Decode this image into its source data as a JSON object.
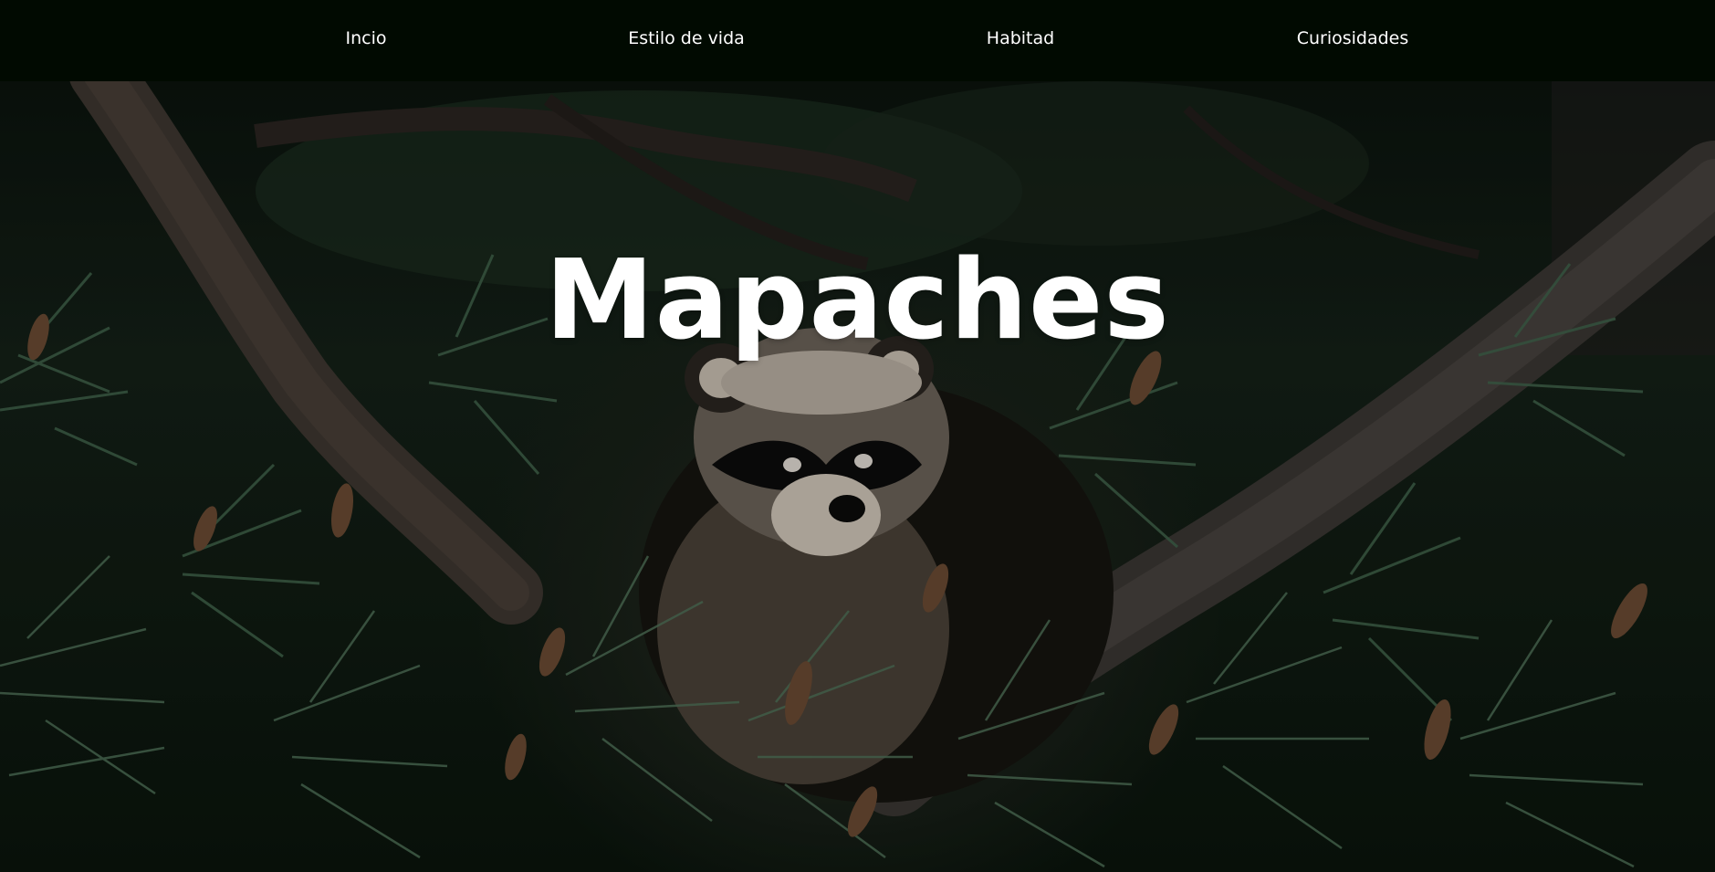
{
  "nav": {
    "items": [
      {
        "label": "Incio"
      },
      {
        "label": "Estilo de vida"
      },
      {
        "label": "Habitad"
      },
      {
        "label": "Curiosidades"
      }
    ]
  },
  "hero": {
    "title": "Mapaches",
    "background": "raccoon-in-pine-tree-photo"
  },
  "colors": {
    "nav_background": "#010a01",
    "nav_text": "#ffffff",
    "title_text": "#ffffff"
  }
}
